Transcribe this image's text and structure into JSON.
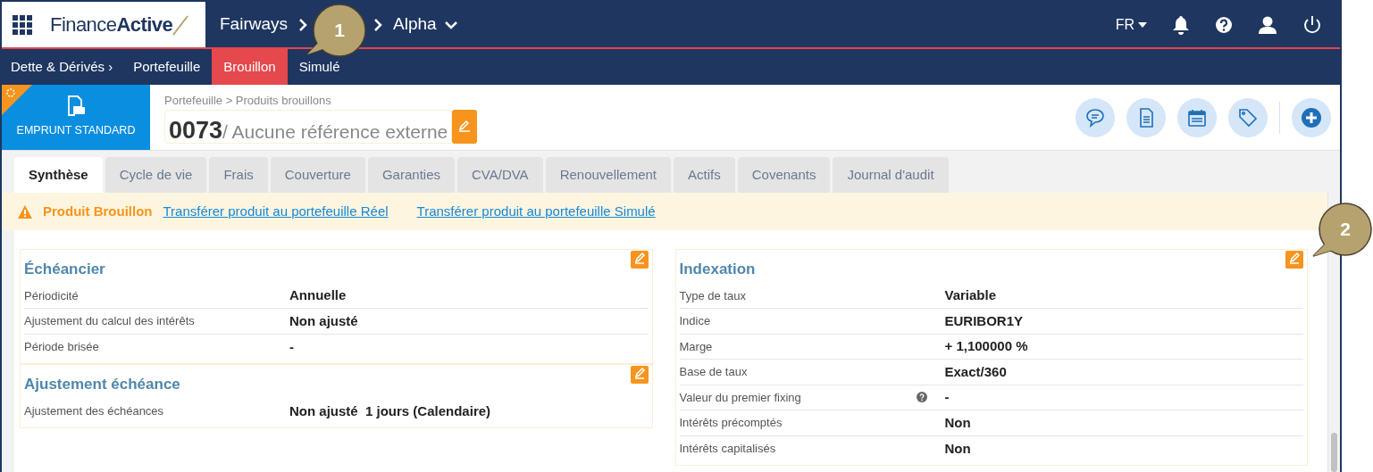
{
  "app": {
    "logo_regular": "Finance",
    "logo_bold": "Active"
  },
  "breadcrumb": {
    "first": "Fairways",
    "last": "Alpha"
  },
  "language": "FR",
  "subnav": {
    "root": "Dette & Dérivés ›",
    "items": [
      {
        "label": "Portefeuille",
        "selected": false
      },
      {
        "label": "Brouillon",
        "selected": true
      },
      {
        "label": "Simulé",
        "selected": false
      }
    ]
  },
  "product": {
    "type_label": "EMPRUNT STANDARD",
    "path": "Portefeuille > Produits brouillons",
    "number": "0073",
    "reference": "/ Aucune référence externe"
  },
  "tabs": [
    {
      "label": "Synthèse",
      "selected": true
    },
    {
      "label": "Cycle de vie",
      "selected": false
    },
    {
      "label": "Frais",
      "selected": false
    },
    {
      "label": "Couverture",
      "selected": false
    },
    {
      "label": "Garanties",
      "selected": false
    },
    {
      "label": "CVA/DVA",
      "selected": false
    },
    {
      "label": "Renouvellement",
      "selected": false
    },
    {
      "label": "Actifs",
      "selected": false
    },
    {
      "label": "Covenants",
      "selected": false
    },
    {
      "label": "Journal d'audit",
      "selected": false
    }
  ],
  "banner": {
    "title": "Produit Brouillon",
    "links": [
      "Transférer produit au portefeuille Réel",
      "Transférer produit au portefeuille Simulé"
    ]
  },
  "columns": [
    {
      "sections": [
        {
          "title": "Échéancier",
          "rows": [
            {
              "label": "Périodicité",
              "value": "Annuelle"
            },
            {
              "label": "Ajustement du calcul des intérêts",
              "value": "Non ajusté"
            },
            {
              "label": "Période brisée",
              "value": "-"
            }
          ]
        },
        {
          "title": "Ajustement échéance",
          "rows": [
            {
              "label": "Ajustement des échéances",
              "value": "Non ajusté  1 jours (Calendaire)"
            }
          ]
        }
      ]
    },
    {
      "sections": [
        {
          "title": "Indexation",
          "rows": [
            {
              "label": "Type de taux",
              "value": "Variable"
            },
            {
              "label": "Indice",
              "value": "EURIBOR1Y"
            },
            {
              "label": "Marge",
              "value": "+ 1,100000 %"
            },
            {
              "label": "Base de taux",
              "value": "Exact/360"
            },
            {
              "label": "Valeur du premier fixing",
              "value": "-",
              "help": true
            },
            {
              "label": "Intérêts précomptés",
              "value": "Non"
            },
            {
              "label": "Intérêts capitalisés",
              "value": "Non"
            }
          ]
        }
      ]
    }
  ],
  "callouts": [
    "1",
    "2"
  ]
}
